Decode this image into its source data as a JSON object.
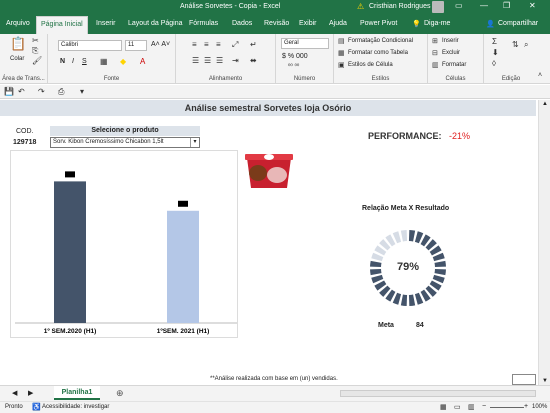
{
  "titlebar": {
    "title": "Análise Sorvetes - Copia  -  Excel",
    "user": "Cristhian Rodrigues",
    "controls": [
      "ribbon-display",
      "minimize",
      "restore",
      "close"
    ]
  },
  "tabs": [
    "Arquivo",
    "Página Inicial",
    "Inserir",
    "Layout da Página",
    "Fórmulas",
    "Dados",
    "Revisão",
    "Exibir",
    "Ajuda",
    "Power Pivot",
    "Diga-me",
    "Compartilhar"
  ],
  "active_tab": "Página Inicial",
  "ribbon": {
    "paste_label": "Colar",
    "font_name": "Calibri",
    "font_size": "11",
    "number_format": "Geral",
    "cond_format": "Formatação Condicional",
    "format_table": "Formatar como Tabela",
    "cell_styles": "Estilos de Célula",
    "insert": "Inserir",
    "delete": "Excluir",
    "format": "Formatar",
    "groups": [
      "Área de Trans...",
      "Fonte",
      "Alinhamento",
      "Número",
      "Estilos",
      "Células",
      "Edição"
    ]
  },
  "sheet": {
    "title": "Análise semestral Sorvetes loja Osório",
    "cod_label": "COD.",
    "cod_value": "129718",
    "select_label": "Selecione  o produto",
    "product": "Sorv. Kibon Cremosíssimo Chicabon 1,5lt",
    "performance_label": "PERFORMANCE:",
    "performance_value": "-21%",
    "gauge_title": "Relação Meta X Resultado",
    "gauge_value": "79%",
    "meta_label": "Meta",
    "meta_value": "84",
    "footnote": "**Análise realizada com base em (un) vendidas."
  },
  "chart_data": {
    "type": "bar",
    "categories": [
      "1º SEM.2020 (H1)",
      "1ºSEM. 2021 (H1)"
    ],
    "values": [
      106,
      84
    ],
    "colors": [
      "#44546a",
      "#b4c7e7"
    ],
    "ylim": [
      0,
      125
    ]
  },
  "gauge": {
    "percent": 0.79,
    "filled_color": "#44546a",
    "empty_color": "#d6dce5"
  },
  "sheettabs": {
    "sheet": "Planilha1"
  },
  "status": {
    "ready": "Pronto",
    "accessibility": "Acessibilidade: investigar",
    "zoom": "100%"
  }
}
